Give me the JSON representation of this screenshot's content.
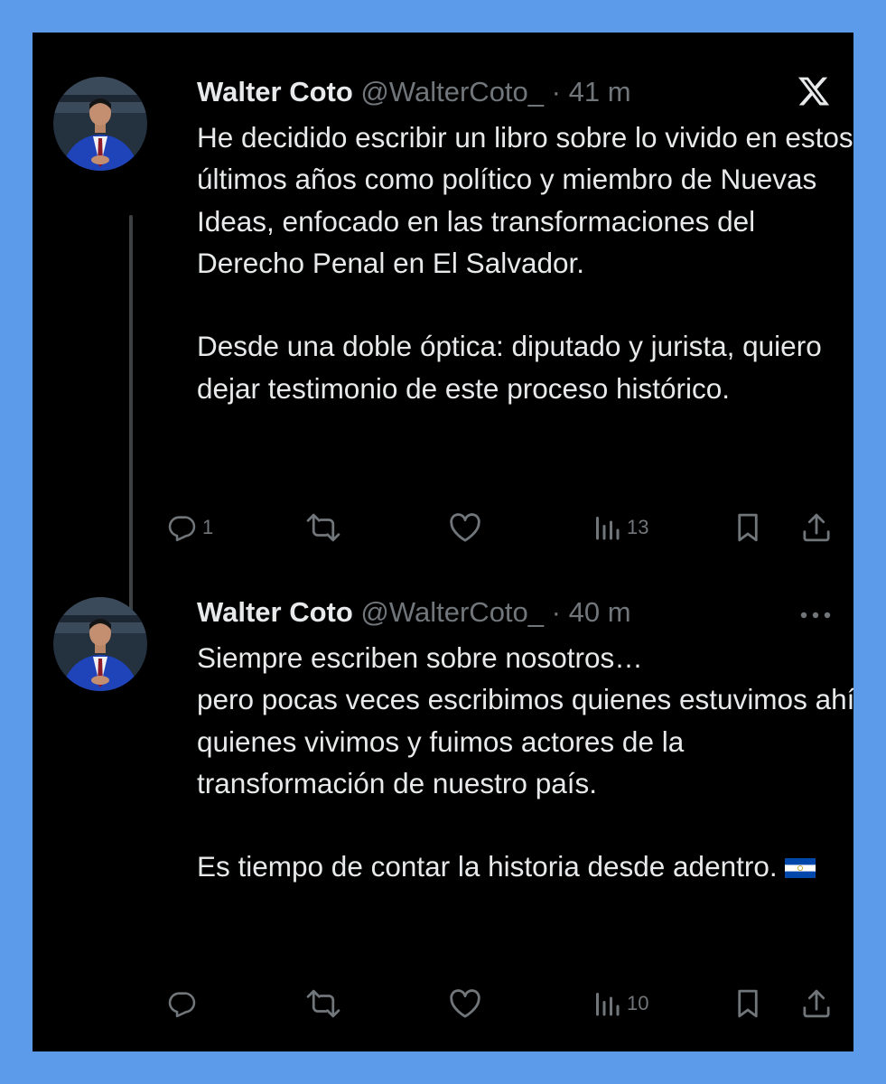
{
  "tweets": [
    {
      "author_name": "Walter Coto",
      "handle": "@WalterCoto_",
      "separator": "·",
      "time": "41 m",
      "paragraphs": [
        "He decidido escribir un libro sobre lo vivido en estos últimos años como político y miembro de Nuevas Ideas, enfocado en las transformaciones del Derecho Penal en El Salvador.",
        "Desde una doble óptica: diputado y jurista, quiero dejar testimonio de este proceso histórico."
      ],
      "actions": {
        "replies": "1",
        "reposts": "",
        "likes": "",
        "views": "13"
      }
    },
    {
      "author_name": "Walter Coto",
      "handle": "@WalterCoto_",
      "separator": "·",
      "time": "40 m",
      "paragraphs": [
        "Siempre escriben sobre nosotros…\npero pocas veces escribimos quienes estuvimos ahí, quienes vivimos y fuimos actores de la transformación de nuestro país.",
        "Es tiempo de contar la historia desde adentro."
      ],
      "actions": {
        "replies": "",
        "reposts": "",
        "likes": "",
        "views": "10"
      }
    }
  ],
  "icons": {
    "brand": "x-logo-icon",
    "menu": "more-horizontal-icon",
    "flag": "el-salvador-flag-icon"
  },
  "colors": {
    "page_background": "#5b9bea",
    "card_background": "#000000",
    "primary_text": "#e7e9ea",
    "secondary_text": "#71767b",
    "flag_blue": "#0047ab"
  }
}
